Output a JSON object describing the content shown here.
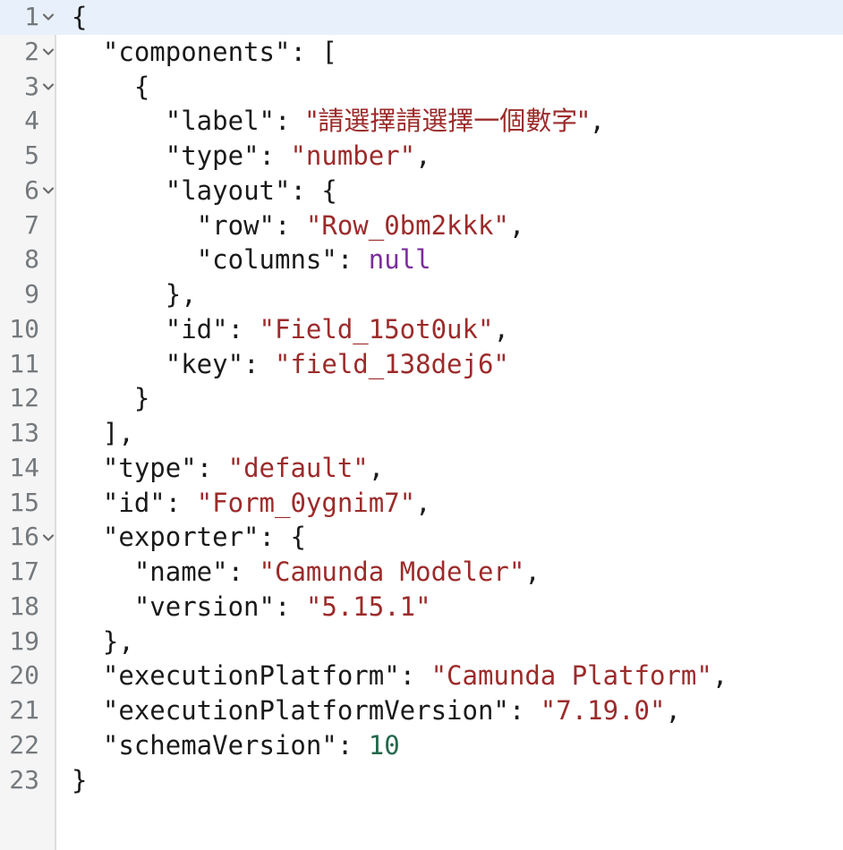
{
  "editor": {
    "language": "json",
    "active_line": 1,
    "colors": {
      "background": "#ffffff",
      "gutter_background": "#f5f5f5",
      "gutter_border": "#dddddd",
      "active_line_background": "#e8f1fb",
      "line_number": "#74797d",
      "text": "#1a1a1a",
      "string": "#9c2b2b",
      "number": "#23684b",
      "null_literal": "#7b2d9b"
    },
    "fold_icon": "chevron-down-icon",
    "lines": [
      {
        "number": "1",
        "fold": true,
        "active": true,
        "indent": 0,
        "tokens": [
          {
            "t": "punct",
            "v": "{"
          }
        ]
      },
      {
        "number": "2",
        "fold": true,
        "active": false,
        "indent": 2,
        "tokens": [
          {
            "t": "key",
            "v": "\"components\""
          },
          {
            "t": "punct",
            "v": ": "
          },
          {
            "t": "punct",
            "v": "["
          }
        ]
      },
      {
        "number": "3",
        "fold": true,
        "active": false,
        "indent": 4,
        "tokens": [
          {
            "t": "punct",
            "v": "{"
          }
        ]
      },
      {
        "number": "4",
        "fold": false,
        "active": false,
        "indent": 6,
        "tokens": [
          {
            "t": "key",
            "v": "\"label\""
          },
          {
            "t": "punct",
            "v": ": "
          },
          {
            "t": "string",
            "v": "\"請選擇請選擇一個數字\""
          },
          {
            "t": "punct",
            "v": ","
          }
        ]
      },
      {
        "number": "5",
        "fold": false,
        "active": false,
        "indent": 6,
        "tokens": [
          {
            "t": "key",
            "v": "\"type\""
          },
          {
            "t": "punct",
            "v": ": "
          },
          {
            "t": "string",
            "v": "\"number\""
          },
          {
            "t": "punct",
            "v": ","
          }
        ]
      },
      {
        "number": "6",
        "fold": true,
        "active": false,
        "indent": 6,
        "tokens": [
          {
            "t": "key",
            "v": "\"layout\""
          },
          {
            "t": "punct",
            "v": ": "
          },
          {
            "t": "punct",
            "v": "{"
          }
        ]
      },
      {
        "number": "7",
        "fold": false,
        "active": false,
        "indent": 8,
        "tokens": [
          {
            "t": "key",
            "v": "\"row\""
          },
          {
            "t": "punct",
            "v": ": "
          },
          {
            "t": "string",
            "v": "\"Row_0bm2kkk\""
          },
          {
            "t": "punct",
            "v": ","
          }
        ]
      },
      {
        "number": "8",
        "fold": false,
        "active": false,
        "indent": 8,
        "tokens": [
          {
            "t": "key",
            "v": "\"columns\""
          },
          {
            "t": "punct",
            "v": ": "
          },
          {
            "t": "null",
            "v": "null"
          }
        ]
      },
      {
        "number": "9",
        "fold": false,
        "active": false,
        "indent": 6,
        "tokens": [
          {
            "t": "punct",
            "v": "},"
          }
        ]
      },
      {
        "number": "10",
        "fold": false,
        "active": false,
        "indent": 6,
        "tokens": [
          {
            "t": "key",
            "v": "\"id\""
          },
          {
            "t": "punct",
            "v": ": "
          },
          {
            "t": "string",
            "v": "\"Field_15ot0uk\""
          },
          {
            "t": "punct",
            "v": ","
          }
        ]
      },
      {
        "number": "11",
        "fold": false,
        "active": false,
        "indent": 6,
        "tokens": [
          {
            "t": "key",
            "v": "\"key\""
          },
          {
            "t": "punct",
            "v": ": "
          },
          {
            "t": "string",
            "v": "\"field_138dej6\""
          }
        ]
      },
      {
        "number": "12",
        "fold": false,
        "active": false,
        "indent": 4,
        "tokens": [
          {
            "t": "punct",
            "v": "}"
          }
        ]
      },
      {
        "number": "13",
        "fold": false,
        "active": false,
        "indent": 2,
        "tokens": [
          {
            "t": "punct",
            "v": "],"
          }
        ]
      },
      {
        "number": "14",
        "fold": false,
        "active": false,
        "indent": 2,
        "tokens": [
          {
            "t": "key",
            "v": "\"type\""
          },
          {
            "t": "punct",
            "v": ": "
          },
          {
            "t": "string",
            "v": "\"default\""
          },
          {
            "t": "punct",
            "v": ","
          }
        ]
      },
      {
        "number": "15",
        "fold": false,
        "active": false,
        "indent": 2,
        "tokens": [
          {
            "t": "key",
            "v": "\"id\""
          },
          {
            "t": "punct",
            "v": ": "
          },
          {
            "t": "string",
            "v": "\"Form_0ygnim7\""
          },
          {
            "t": "punct",
            "v": ","
          }
        ]
      },
      {
        "number": "16",
        "fold": true,
        "active": false,
        "indent": 2,
        "tokens": [
          {
            "t": "key",
            "v": "\"exporter\""
          },
          {
            "t": "punct",
            "v": ": "
          },
          {
            "t": "punct",
            "v": "{"
          }
        ]
      },
      {
        "number": "17",
        "fold": false,
        "active": false,
        "indent": 4,
        "tokens": [
          {
            "t": "key",
            "v": "\"name\""
          },
          {
            "t": "punct",
            "v": ": "
          },
          {
            "t": "string",
            "v": "\"Camunda Modeler\""
          },
          {
            "t": "punct",
            "v": ","
          }
        ]
      },
      {
        "number": "18",
        "fold": false,
        "active": false,
        "indent": 4,
        "tokens": [
          {
            "t": "key",
            "v": "\"version\""
          },
          {
            "t": "punct",
            "v": ": "
          },
          {
            "t": "string",
            "v": "\"5.15.1\""
          }
        ]
      },
      {
        "number": "19",
        "fold": false,
        "active": false,
        "indent": 2,
        "tokens": [
          {
            "t": "punct",
            "v": "},"
          }
        ]
      },
      {
        "number": "20",
        "fold": false,
        "active": false,
        "indent": 2,
        "tokens": [
          {
            "t": "key",
            "v": "\"executionPlatform\""
          },
          {
            "t": "punct",
            "v": ": "
          },
          {
            "t": "string",
            "v": "\"Camunda Platform\""
          },
          {
            "t": "punct",
            "v": ","
          }
        ]
      },
      {
        "number": "21",
        "fold": false,
        "active": false,
        "indent": 2,
        "tokens": [
          {
            "t": "key",
            "v": "\"executionPlatformVersion\""
          },
          {
            "t": "punct",
            "v": ": "
          },
          {
            "t": "string",
            "v": "\"7.19.0\""
          },
          {
            "t": "punct",
            "v": ","
          }
        ]
      },
      {
        "number": "22",
        "fold": false,
        "active": false,
        "indent": 2,
        "tokens": [
          {
            "t": "key",
            "v": "\"schemaVersion\""
          },
          {
            "t": "punct",
            "v": ": "
          },
          {
            "t": "number",
            "v": "10"
          }
        ]
      },
      {
        "number": "23",
        "fold": false,
        "active": false,
        "indent": 0,
        "tokens": [
          {
            "t": "punct",
            "v": "}"
          }
        ]
      }
    ]
  }
}
